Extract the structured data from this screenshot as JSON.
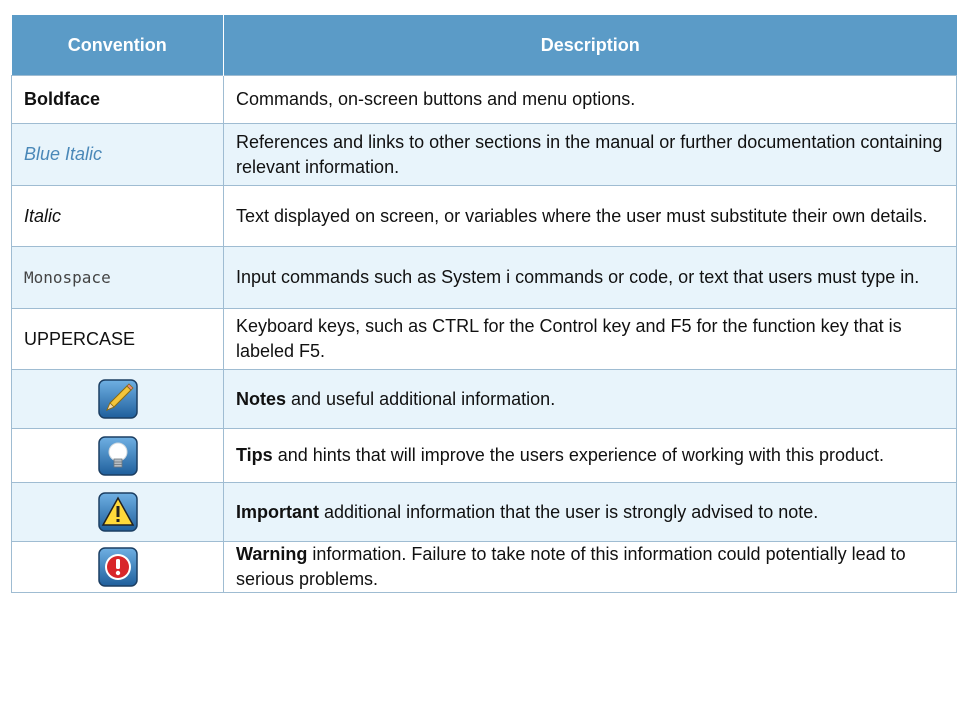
{
  "header": {
    "convention": "Convention",
    "description": "Description"
  },
  "rows": [
    {
      "convention": "Boldface",
      "description": "Commands, on-screen buttons and menu options."
    },
    {
      "convention": "Blue Italic",
      "description": "References and links to other sections in the manual or further documentation containing relevant information."
    },
    {
      "convention": "Italic",
      "description": "Text displayed on screen, or variables where the user must substitute their own details."
    },
    {
      "convention": "Monospace",
      "description": "Input commands such as System i commands or code, or text that users must type in."
    },
    {
      "convention": "UPPERCASE",
      "description": "Keyboard keys, such as CTRL for the Control key and F5 for the function key that is labeled F5."
    }
  ],
  "icon_rows": [
    {
      "icon": "pencil-icon",
      "term": "Notes",
      "description": " and useful additional information."
    },
    {
      "icon": "lightbulb-icon",
      "term": "Tips",
      "description": " and hints that will improve the users experience of working with this product."
    },
    {
      "icon": "warning-icon",
      "term": "Important",
      "description": " additional information that the user is strongly advised to note."
    },
    {
      "icon": "exclamation-icon",
      "term": "Warning",
      "description": " information. Failure to take note of this information could potentially lead to serious problems."
    }
  ],
  "colors": {
    "header_bg": "#5b9bc7",
    "alt_row_bg": "#e8f4fb",
    "border": "#9fbcd2",
    "blue_italic": "#4a88b8"
  }
}
